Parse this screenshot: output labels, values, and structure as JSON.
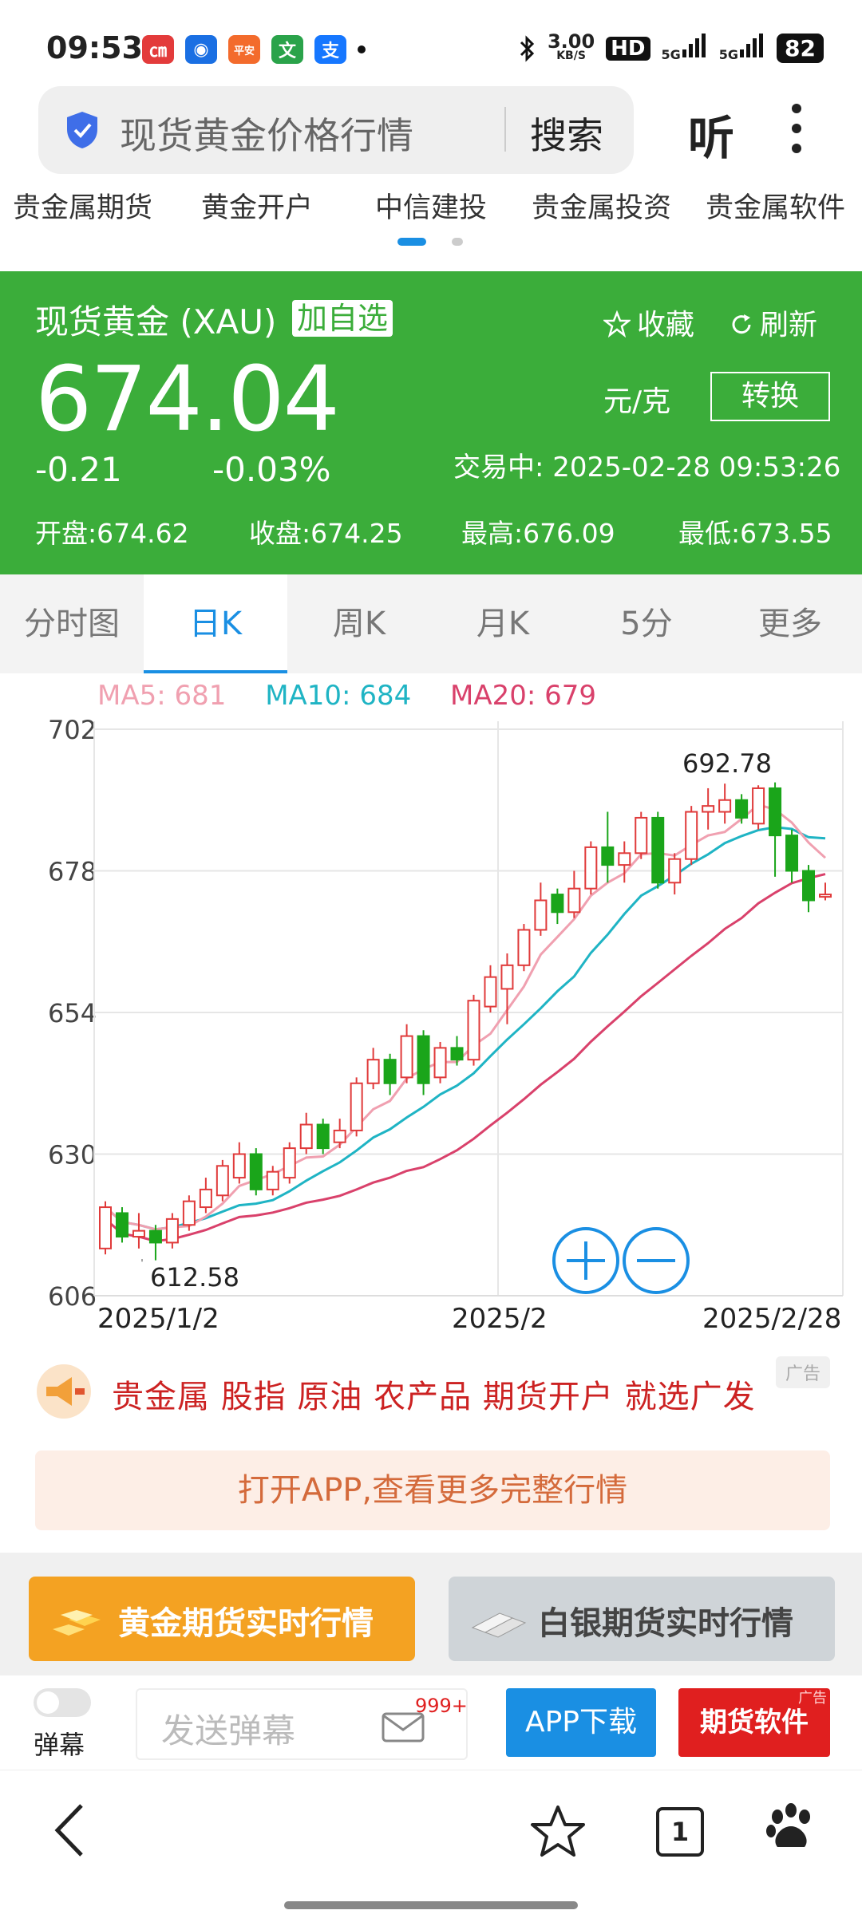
{
  "status_bar": {
    "time": "09:53",
    "app_icons": [
      {
        "name": "app-icon-1",
        "color": "#e33b3b",
        "glyph": "㎝"
      },
      {
        "name": "app-icon-2",
        "color": "#1a6fe3",
        "glyph": "◉"
      },
      {
        "name": "app-icon-3",
        "color": "#f36b2c",
        "glyph": "平安"
      },
      {
        "name": "app-icon-4",
        "color": "#2aa34a",
        "glyph": "文"
      },
      {
        "name": "app-icon-5",
        "color": "#1677ff",
        "glyph": "支"
      }
    ],
    "network_speed": "3.00",
    "network_unit": "KB/S",
    "hd_label": "HD",
    "signal_1": "5G",
    "signal_2": "5G",
    "battery": "82"
  },
  "search": {
    "query": "现货黄金价格行情",
    "button": "搜索",
    "listen": "听"
  },
  "top_nav": [
    "贵金属期货",
    "黄金开户",
    "中信建投",
    "贵金属投资",
    "贵金属软件"
  ],
  "quote": {
    "name": "现货黄金 (XAU)",
    "add_watchlist": "加自选",
    "favorite": "收藏",
    "refresh": "刷新",
    "price": "674.04",
    "unit": "元/克",
    "convert": "转换",
    "change": "-0.21",
    "change_pct": "-0.03%",
    "status": "交易中: 2025-02-28 09:53:26",
    "open": "开盘:674.62",
    "prev_close": "收盘:674.25",
    "high": "最高:676.09",
    "low": "最低:673.55",
    "colors": {
      "panel": "#3bad3a"
    }
  },
  "tabs": [
    {
      "label": "分时图",
      "active": false
    },
    {
      "label": "日K",
      "active": true
    },
    {
      "label": "周K",
      "active": false
    },
    {
      "label": "月K",
      "active": false
    },
    {
      "label": "5分",
      "active": false
    },
    {
      "label": "更多",
      "active": false
    }
  ],
  "ma_legend": {
    "ma5": "MA5: 681",
    "ma10": "MA10: 684",
    "ma20": "MA20: 679",
    "colors": {
      "ma5": "#f0a0b0",
      "ma10": "#1fb4c4",
      "ma20": "#d9416b"
    }
  },
  "chart_data": {
    "type": "candlestick",
    "y_ticks": [
      "702",
      "678",
      "654",
      "630",
      "606"
    ],
    "ylim": [
      606,
      702
    ],
    "x_labels": [
      "2025/1/2",
      "2025/2",
      "2025/2/28"
    ],
    "annotations": {
      "max": "692.78",
      "min": "612.58"
    },
    "colors": {
      "up": "#e03a3a",
      "down": "#1aa51a"
    },
    "candles": [
      {
        "o": 614,
        "c": 621,
        "h": 622,
        "l": 613
      },
      {
        "o": 620,
        "c": 616,
        "h": 621,
        "l": 615
      },
      {
        "o": 616,
        "c": 617,
        "h": 620,
        "l": 614
      },
      {
        "o": 617,
        "c": 615,
        "h": 618,
        "l": 612
      },
      {
        "o": 615,
        "c": 619,
        "h": 620,
        "l": 614
      },
      {
        "o": 618,
        "c": 622,
        "h": 623,
        "l": 617
      },
      {
        "o": 621,
        "c": 624,
        "h": 626,
        "l": 620
      },
      {
        "o": 623,
        "c": 628,
        "h": 629,
        "l": 622
      },
      {
        "o": 626,
        "c": 630,
        "h": 632,
        "l": 625
      },
      {
        "o": 630,
        "c": 624,
        "h": 631,
        "l": 623
      },
      {
        "o": 624,
        "c": 627,
        "h": 628,
        "l": 623
      },
      {
        "o": 626,
        "c": 631,
        "h": 632,
        "l": 625
      },
      {
        "o": 631,
        "c": 635,
        "h": 637,
        "l": 630
      },
      {
        "o": 635,
        "c": 631,
        "h": 636,
        "l": 630
      },
      {
        "o": 632,
        "c": 634,
        "h": 636,
        "l": 631
      },
      {
        "o": 634,
        "c": 642,
        "h": 643,
        "l": 633
      },
      {
        "o": 642,
        "c": 646,
        "h": 648,
        "l": 641
      },
      {
        "o": 646,
        "c": 642,
        "h": 647,
        "l": 640
      },
      {
        "o": 643,
        "c": 650,
        "h": 652,
        "l": 642
      },
      {
        "o": 650,
        "c": 642,
        "h": 651,
        "l": 640
      },
      {
        "o": 643,
        "c": 648,
        "h": 649,
        "l": 642
      },
      {
        "o": 648,
        "c": 646,
        "h": 650,
        "l": 645
      },
      {
        "o": 646,
        "c": 656,
        "h": 657,
        "l": 645
      },
      {
        "o": 655,
        "c": 660,
        "h": 662,
        "l": 654
      },
      {
        "o": 658,
        "c": 662,
        "h": 664,
        "l": 652
      },
      {
        "o": 662,
        "c": 668,
        "h": 669,
        "l": 661
      },
      {
        "o": 668,
        "c": 673,
        "h": 676,
        "l": 667
      },
      {
        "o": 674,
        "c": 671,
        "h": 675,
        "l": 669
      },
      {
        "o": 671,
        "c": 675,
        "h": 678,
        "l": 670
      },
      {
        "o": 675,
        "c": 682,
        "h": 683,
        "l": 674
      },
      {
        "o": 682,
        "c": 679,
        "h": 688,
        "l": 676
      },
      {
        "o": 679,
        "c": 681,
        "h": 683,
        "l": 676
      },
      {
        "o": 681,
        "c": 687,
        "h": 688,
        "l": 680
      },
      {
        "o": 687,
        "c": 676,
        "h": 688,
        "l": 675
      },
      {
        "o": 676,
        "c": 680,
        "h": 681,
        "l": 674
      },
      {
        "o": 680,
        "c": 688,
        "h": 689,
        "l": 679
      },
      {
        "o": 688,
        "c": 689,
        "h": 692,
        "l": 685
      },
      {
        "o": 688,
        "c": 690,
        "h": 692.78,
        "l": 686
      },
      {
        "o": 690,
        "c": 687,
        "h": 691,
        "l": 686
      },
      {
        "o": 686,
        "c": 692,
        "h": 692.5,
        "l": 685
      },
      {
        "o": 692,
        "c": 684,
        "h": 693,
        "l": 677
      },
      {
        "o": 684,
        "c": 678,
        "h": 685,
        "l": 676
      },
      {
        "o": 678,
        "c": 673,
        "h": 679,
        "l": 671
      },
      {
        "o": 674,
        "c": 674,
        "h": 676,
        "l": 673
      }
    ]
  },
  "ad_banner": {
    "text": "贵金属 股指 原油 农产品 期货开户 就选广发",
    "tag": "广告"
  },
  "open_app": "打开APP,查看更多完整行情",
  "quick_buttons": {
    "gold": "黄金期货实时行情",
    "silver": "白银期货实时行情"
  },
  "bottom_tools": {
    "danmu_label": "弹幕",
    "danmu_placeholder": "发送弹幕",
    "message_badge": "999+",
    "app_download": "APP下载",
    "futures_software": "期货软件",
    "ad_tag": "广告"
  },
  "nav": {
    "tab_count": "1"
  }
}
